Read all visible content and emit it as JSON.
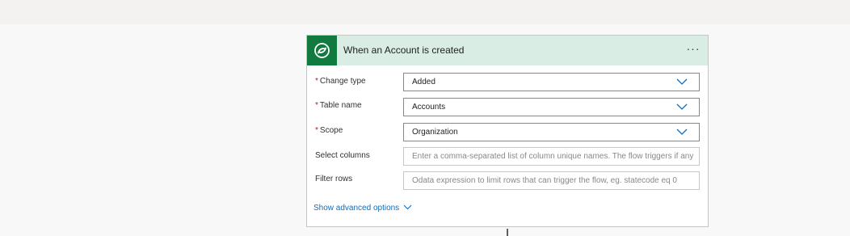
{
  "trigger_card": {
    "title": "When an Account is created",
    "icon": "dataverse-logo-icon",
    "menu_label": "···",
    "header_color": "#d9ede5",
    "icon_bg_color": "#117a3e",
    "fields": {
      "change_type": {
        "required_mark": "*",
        "label": "Change type",
        "value": "Added"
      },
      "table_name": {
        "required_mark": "*",
        "label": "Table name",
        "value": "Accounts"
      },
      "scope": {
        "required_mark": "*",
        "label": "Scope",
        "value": "Organization"
      },
      "select_columns": {
        "label": "Select columns",
        "placeholder": "Enter a comma-separated list of column unique names. The flow triggers if any"
      },
      "filter_rows": {
        "label": "Filter rows",
        "placeholder": "Odata expression to limit rows that can trigger the flow, eg. statecode eq 0"
      }
    },
    "advanced_options_label": "Show advanced options",
    "link_color": "#0f6cbd"
  }
}
